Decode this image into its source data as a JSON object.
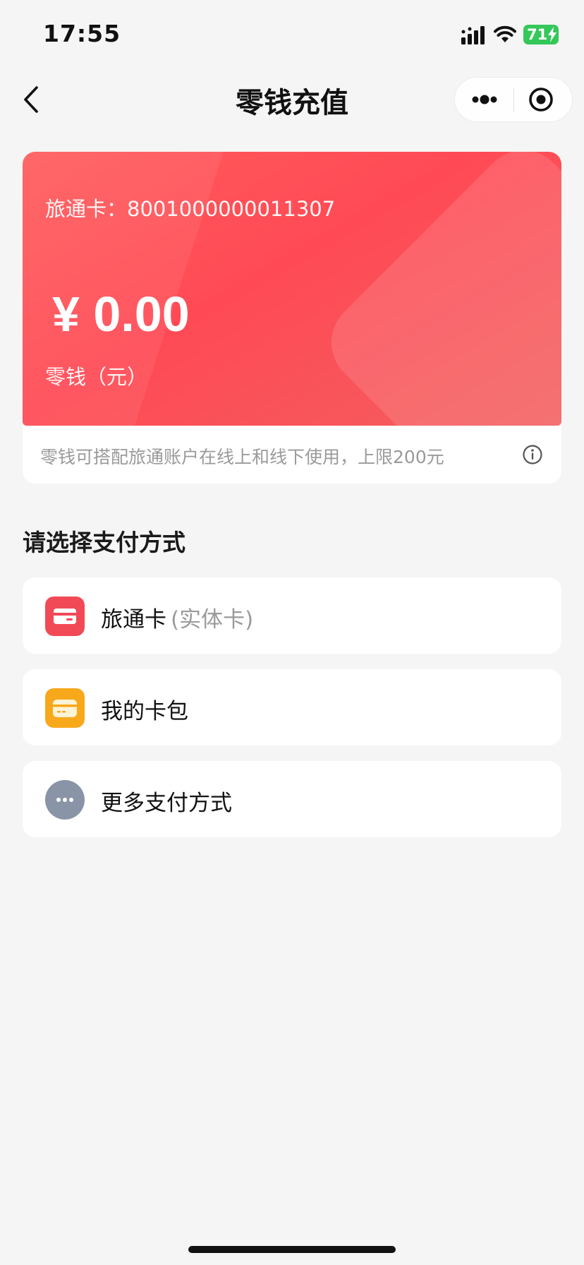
{
  "status_bar": {
    "time": "17:55",
    "battery_level": "71",
    "icons": [
      "signal-icon",
      "wifi-icon",
      "battery-icon"
    ],
    "battery_color": "#34c759"
  },
  "nav": {
    "title": "零钱充值",
    "back_icon": "chevron-left-icon",
    "more_icon": "more-dots-icon",
    "close_icon": "target-close-icon"
  },
  "balance_card": {
    "card_number_label": "旅通卡：8001000000011307",
    "amount": "¥ 0.00",
    "unit_label": "零钱（元）",
    "tip": "零钱可搭配旅通账户在线上和线下使用，上限200元",
    "tip_icon": "info-icon",
    "gradient_start": "#ff5c5c",
    "gradient_end": "#f25f5f"
  },
  "payment": {
    "section_title": "请选择支付方式",
    "options": [
      {
        "label": "旅通卡",
        "sub": "(实体卡)",
        "icon": "card-icon",
        "icon_color": "#f24957"
      },
      {
        "label": "我的卡包",
        "sub": "",
        "icon": "wallet-icon",
        "icon_color": "#f7a81b"
      },
      {
        "label": "更多支付方式",
        "sub": "",
        "icon": "more-icon",
        "icon_color": "#8994a6"
      }
    ]
  }
}
